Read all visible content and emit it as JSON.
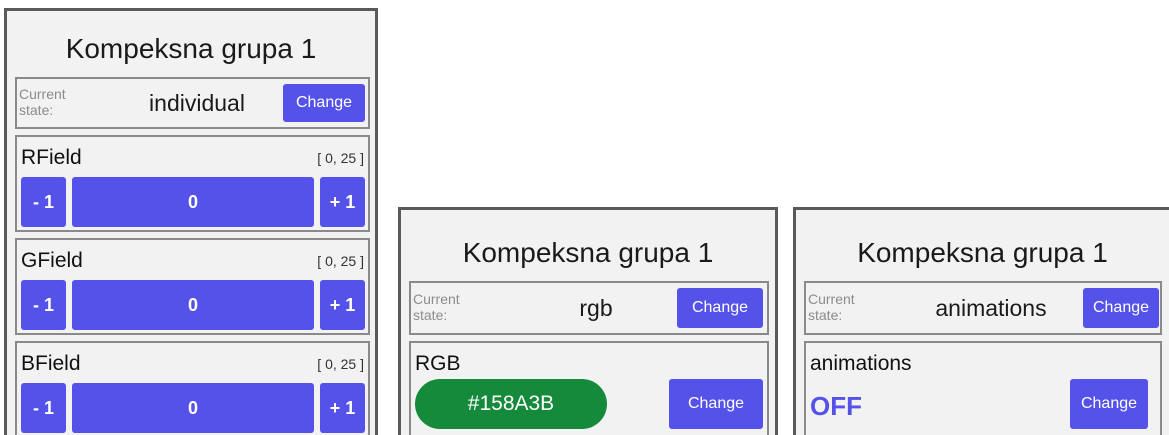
{
  "panel_individual": {
    "title": "Kompeksna grupa 1",
    "state_label": "Current\nstate:",
    "state_value": "individual",
    "change_label": "Change",
    "fields": [
      {
        "name": "RField",
        "range": "[ 0, 25 ]",
        "minus": "- 1",
        "value": "0",
        "plus": "+ 1"
      },
      {
        "name": "GField",
        "range": "[ 0, 25 ]",
        "minus": "- 1",
        "value": "0",
        "plus": "+ 1"
      },
      {
        "name": "BField",
        "range": "[ 0, 25 ]",
        "minus": "- 1",
        "value": "0",
        "plus": "+ 1"
      }
    ]
  },
  "panel_rgb": {
    "title": "Kompeksna grupa 1",
    "state_label": "Current\nstate:",
    "state_value": "rgb",
    "change_label": "Change",
    "field_name": "RGB",
    "color_value": "#158A3B",
    "color_button_label": "Change"
  },
  "panel_animations": {
    "title": "Kompeksna grupa 1",
    "state_label": "Current\nstate:",
    "state_value": "animations",
    "change_label": "Change",
    "field_name": "animations",
    "toggle_value": "OFF",
    "toggle_button_label": "Change"
  },
  "colors": {
    "accent": "#5552EA",
    "swatch": "#158A3B",
    "panel_bg": "#F2F2F2",
    "border": "#8A8A8A"
  }
}
